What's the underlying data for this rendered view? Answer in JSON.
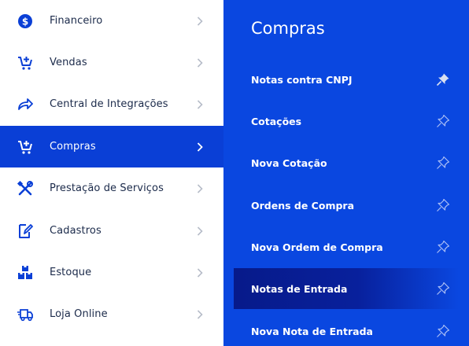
{
  "sidebar": {
    "items": [
      {
        "label": "Financeiro",
        "icon": "dollar-circle-icon"
      },
      {
        "label": "Vendas",
        "icon": "cart-add-icon"
      },
      {
        "label": "Central de Integrações",
        "icon": "share-arrow-icon"
      },
      {
        "label": "Compras",
        "icon": "cart-add-icon",
        "active": true
      },
      {
        "label": "Prestação de Serviços",
        "icon": "tools-icon"
      },
      {
        "label": "Cadastros",
        "icon": "edit-icon"
      },
      {
        "label": "Estoque",
        "icon": "boxes-icon"
      },
      {
        "label": "Loja Online",
        "icon": "delivery-truck-icon"
      }
    ]
  },
  "submenu": {
    "title": "Compras",
    "items": [
      {
        "label": "Notas contra CNPJ",
        "pinned": true
      },
      {
        "label": "Cotações",
        "pinned": false
      },
      {
        "label": "Nova Cotação",
        "pinned": false
      },
      {
        "label": "Ordens de Compra",
        "pinned": false
      },
      {
        "label": "Nova Ordem de Compra",
        "pinned": false
      },
      {
        "label": "Notas de Entrada",
        "pinned": false,
        "active": true
      },
      {
        "label": "Nova Nota de Entrada",
        "pinned": false
      }
    ]
  },
  "colors": {
    "accent": "#0a3fd6",
    "submenu_bg": "#0a47e0",
    "active_sub_bg": "#071a8a",
    "text_dark": "#1b2a4a"
  }
}
